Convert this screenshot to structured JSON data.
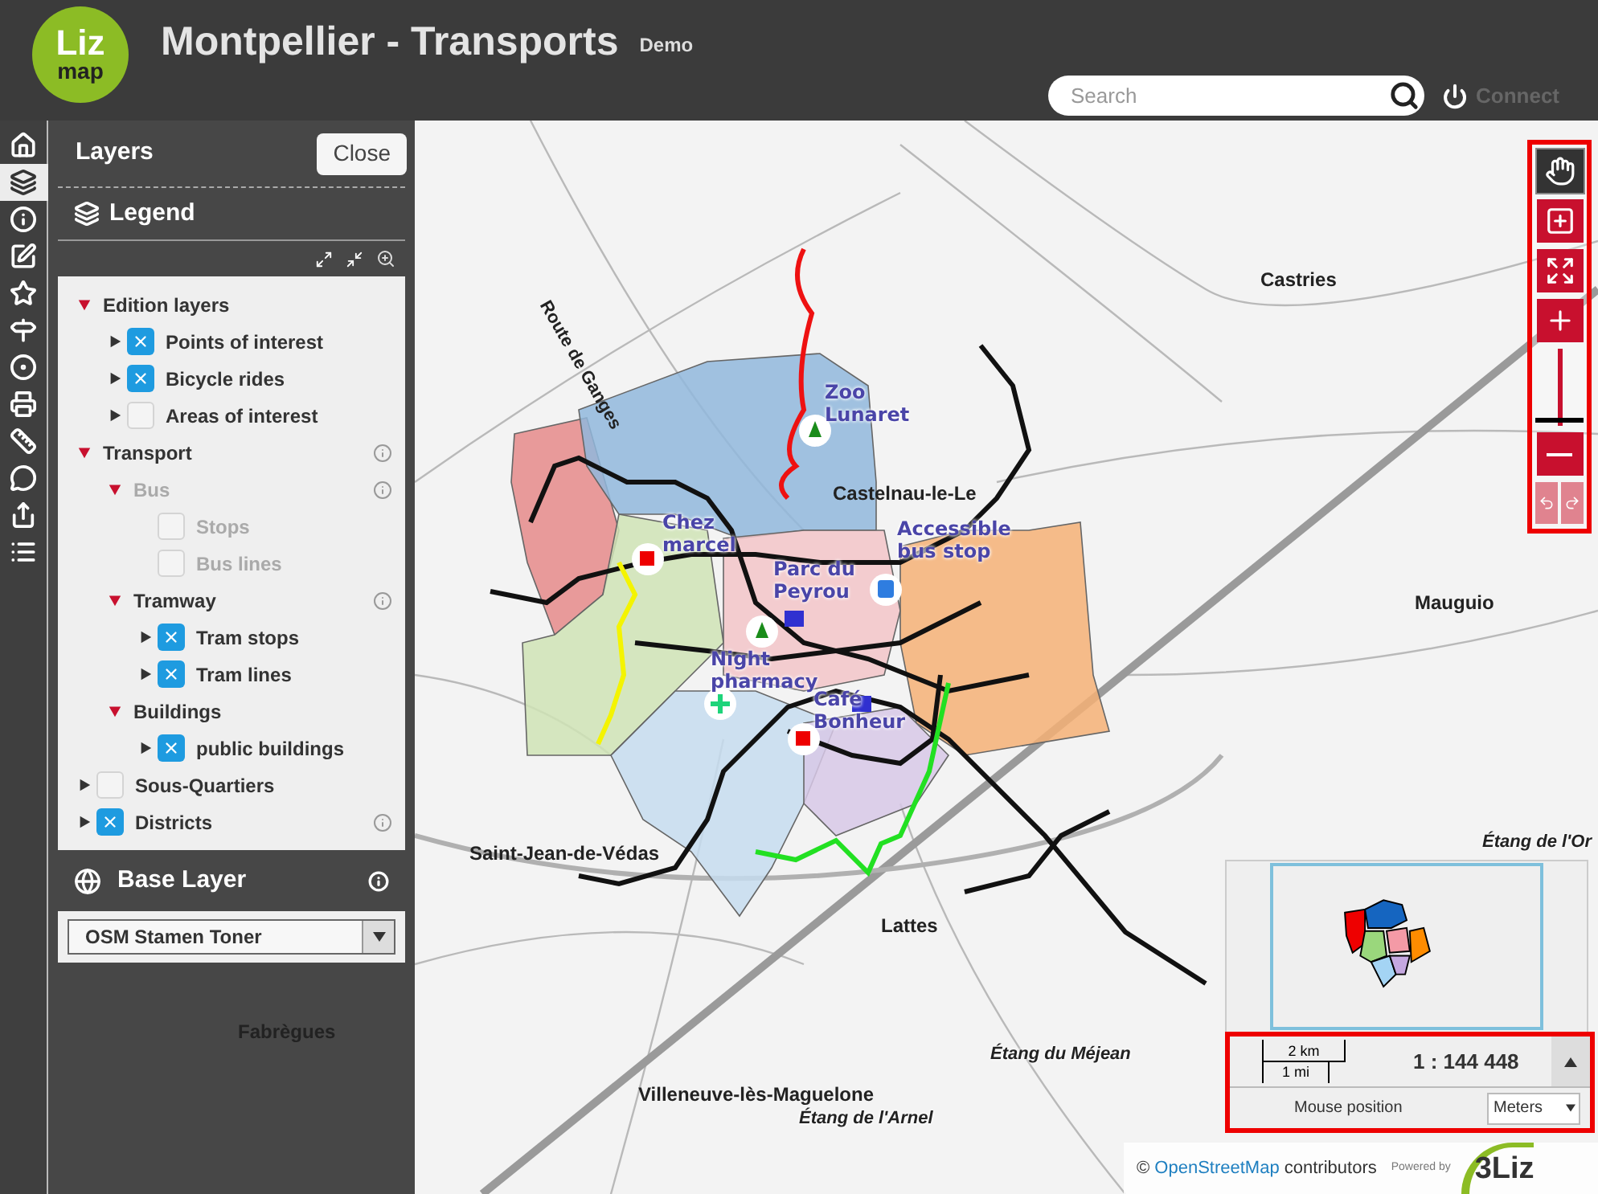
{
  "header": {
    "logo_top": "Liz",
    "logo_bottom": "map",
    "title": "Montpellier - Transports",
    "subtitle": "Demo",
    "search": {
      "placeholder": "Search"
    },
    "connect": "Connect"
  },
  "tools": [
    {
      "selected": false
    },
    {
      "selected": true
    },
    {
      "selected": false
    },
    {
      "selected": false
    },
    {
      "selected": false
    },
    {
      "selected": false
    },
    {
      "selected": false
    },
    {
      "selected": false
    },
    {
      "selected": false
    },
    {
      "selected": false
    },
    {
      "selected": false
    },
    {
      "selected": false
    }
  ],
  "panel": {
    "title": "Layers",
    "close": "Close",
    "legend_title": "Legend",
    "tree": [
      {
        "label": "Edition layers",
        "kind": "group",
        "expanded": true,
        "disabled": false,
        "info": false,
        "children": [
          {
            "label": "Points of interest",
            "kind": "layer",
            "checked": true,
            "disabled": false,
            "info": false
          },
          {
            "label": "Bicycle rides",
            "kind": "layer",
            "checked": true,
            "disabled": false,
            "info": false
          },
          {
            "label": "Areas of interest",
            "kind": "layer",
            "checked": false,
            "disabled": false,
            "info": false
          }
        ]
      },
      {
        "label": "Transport",
        "kind": "group",
        "expanded": true,
        "disabled": false,
        "info": true,
        "children": [
          {
            "label": "Bus",
            "kind": "group",
            "expanded": true,
            "disabled": true,
            "info": true,
            "children": [
              {
                "label": "Stops",
                "kind": "leaf",
                "checked": false,
                "disabled": true,
                "info": false
              },
              {
                "label": "Bus lines",
                "kind": "leaf",
                "checked": false,
                "disabled": true,
                "info": false
              }
            ]
          },
          {
            "label": "Tramway",
            "kind": "group",
            "expanded": true,
            "disabled": false,
            "info": true,
            "children": [
              {
                "label": "Tram stops",
                "kind": "layer",
                "checked": true,
                "disabled": false,
                "info": false
              },
              {
                "label": "Tram lines",
                "kind": "layer",
                "checked": true,
                "disabled": false,
                "info": false
              }
            ]
          },
          {
            "label": "Buildings",
            "kind": "group",
            "expanded": true,
            "disabled": false,
            "info": false,
            "children": [
              {
                "label": "public buildings",
                "kind": "layer",
                "checked": true,
                "disabled": false,
                "info": false
              }
            ]
          }
        ]
      },
      {
        "label": "Sous-Quartiers",
        "kind": "layer",
        "checked": false,
        "disabled": false,
        "info": false
      },
      {
        "label": "Districts",
        "kind": "layer",
        "checked": true,
        "disabled": false,
        "info": true
      }
    ],
    "base_layer_title": "Base Layer",
    "base_layer_value": "OSM Stamen Toner"
  },
  "map": {
    "places": [
      {
        "label": "Route de Ganges",
        "kind": "road"
      },
      {
        "label": "Castries",
        "kind": "town"
      },
      {
        "label": "Zoo Lunaret",
        "kind": "poi"
      },
      {
        "label": "Castelnau-le-Le",
        "kind": "town"
      },
      {
        "label": "Chez marcel",
        "kind": "poi"
      },
      {
        "label": "Accessible bus stop",
        "kind": "poi"
      },
      {
        "label": "Parc du Peyrou",
        "kind": "poi"
      },
      {
        "label": "Night pharmacy",
        "kind": "poi"
      },
      {
        "label": "Café Bonheur",
        "kind": "poi"
      },
      {
        "label": "Mauguio",
        "kind": "town"
      },
      {
        "label": "Saint-Jean-de-Védas",
        "kind": "town"
      },
      {
        "label": "Lattes",
        "kind": "town"
      },
      {
        "label": "Étang de l'Or",
        "kind": "water"
      },
      {
        "label": "Fabrègues",
        "kind": "town"
      },
      {
        "label": "Étang du Méjean",
        "kind": "water"
      },
      {
        "label": "Villeneuve-lès-Maguelone",
        "kind": "town"
      },
      {
        "label": "Étang de l'Arnel",
        "kind": "water"
      }
    ],
    "controls": [
      {
        "kind": "pan",
        "selected": true
      },
      {
        "kind": "zoombox",
        "selected": false
      },
      {
        "kind": "extent",
        "selected": false
      },
      {
        "kind": "zoomin",
        "selected": false
      },
      {
        "kind": "slider",
        "level": 0.05
      },
      {
        "kind": "zoomout",
        "selected": false
      },
      {
        "kind": "history",
        "disabled": true
      }
    ],
    "scale": {
      "km": "2 km",
      "mi": "1 mi",
      "ratio": "1 : 144 448"
    },
    "mouse_position": {
      "label": "Mouse position",
      "unit": "Meters"
    },
    "attribution": {
      "prefix": "©",
      "link": "OpenStreetMap",
      "suffix": "contributors",
      "powered": "Powered by",
      "brand": "3Liz"
    }
  }
}
